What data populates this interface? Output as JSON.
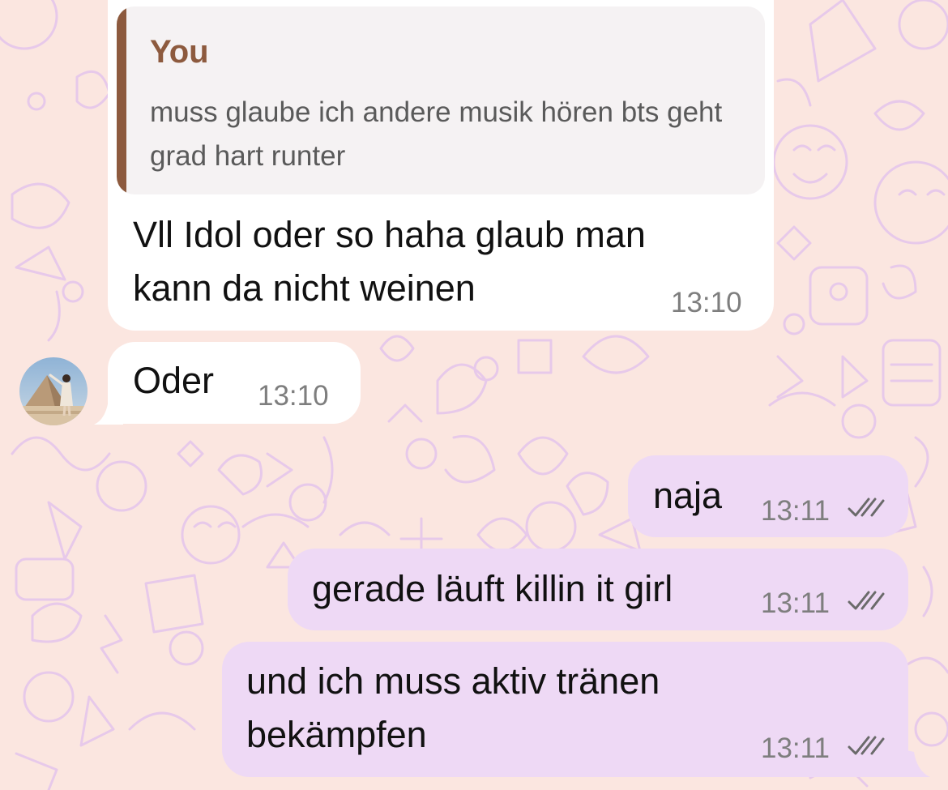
{
  "colors": {
    "background": "#fbe6e0",
    "wallpaper_doodles": "#e7c9ea",
    "incoming_bubble": "#ffffff",
    "outgoing_bubble": "#eed9f5",
    "quote_accent": "#8d5a3e",
    "timestamp": "#7e7e7e"
  },
  "messages": [
    {
      "direction": "incoming",
      "reply_to": {
        "author": "You",
        "text": "muss glaube ich andere musik hören bts geht grad hart runter"
      },
      "lines": [
        "Vll Idol oder so haha glaub man",
        "kann da nicht weinen"
      ],
      "time": "13:10"
    },
    {
      "direction": "incoming",
      "lines": [
        "Oder"
      ],
      "time": "13:10",
      "sender_avatar": "contact-avatar"
    },
    {
      "direction": "outgoing",
      "lines": [
        "naja"
      ],
      "time": "13:11",
      "status_icon": "double-check-icon"
    },
    {
      "direction": "outgoing",
      "lines": [
        "gerade läuft killin it girl"
      ],
      "time": "13:11",
      "status_icon": "double-check-icon"
    },
    {
      "direction": "outgoing",
      "lines": [
        "und ich muss aktiv tränen",
        "bekämpfen"
      ],
      "time": "13:11",
      "status_icon": "double-check-icon"
    }
  ]
}
